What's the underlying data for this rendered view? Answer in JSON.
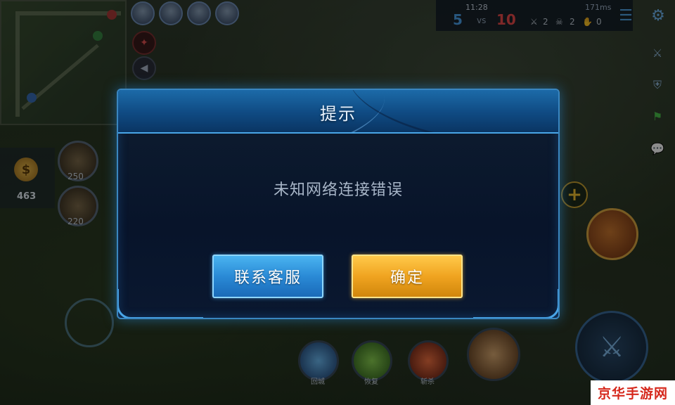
{
  "dialog": {
    "title": "提示",
    "message": "未知网络连接错误",
    "contact_button": "联系客服",
    "confirm_button": "确定"
  },
  "hud": {
    "clock": "11:28",
    "score_blue": "5",
    "score_vs": "vs",
    "score_red": "10",
    "kills": "2",
    "deaths": "2",
    "assists": "0",
    "ping": "171ms",
    "gold": "463",
    "item_prices": [
      "250",
      "220"
    ],
    "skill_labels": [
      "回城",
      "恢复",
      "斩杀"
    ]
  },
  "watermark": "京华手游网",
  "colors": {
    "dialog_border": "#3a86c0",
    "contact_button": "#2a8ad6",
    "confirm_button": "#f0a420"
  }
}
